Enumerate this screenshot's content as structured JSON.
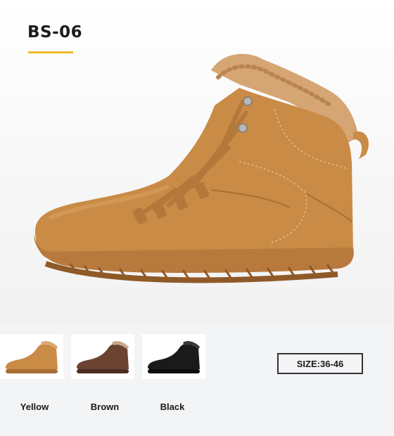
{
  "product": {
    "model": "BS-06",
    "accent_color": "#f0b829",
    "hero_color": "#c98b45"
  },
  "variants": [
    {
      "label": "Yellow",
      "color": "#c98b45"
    },
    {
      "label": "Brown",
      "color": "#6b4330"
    },
    {
      "label": "Black",
      "color": "#1a1a1a"
    }
  ],
  "size": {
    "label": "SIZE:36-46"
  }
}
